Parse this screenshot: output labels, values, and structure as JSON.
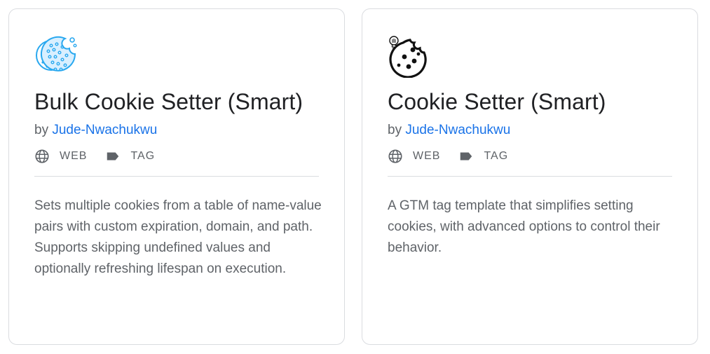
{
  "cards": [
    {
      "logo_icon": "blue-cookie-icon",
      "title": "Bulk Cookie Setter (Smart)",
      "by_label": "by",
      "author": "Jude-Nwachukwu",
      "platform": "WEB",
      "type": "TAG",
      "description": "Sets multiple cookies from a table of name-value pairs with custom expiration, domain, and path. Supports skipping undefined values and optionally refreshing lifespan on execution."
    },
    {
      "logo_icon": "black-cookie-lightbulb-icon",
      "title": "Cookie Setter (Smart)",
      "by_label": "by",
      "author": "Jude-Nwachukwu",
      "platform": "WEB",
      "type": "TAG",
      "description": "A GTM tag template that simplifies setting cookies, with advanced options to control their behavior."
    }
  ],
  "colors": {
    "link": "#1a73e8",
    "text_secondary": "#5f6368",
    "title": "#202124",
    "border": "#dadce0",
    "cookie_blue": "#29a8ef"
  }
}
